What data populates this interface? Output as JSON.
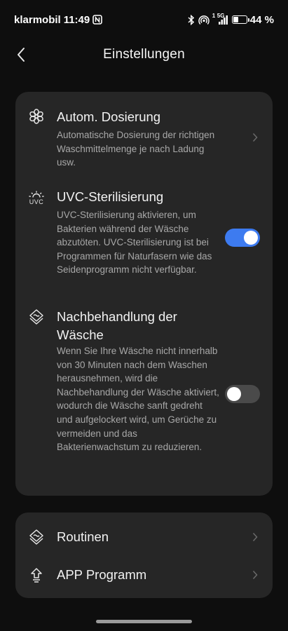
{
  "status_bar": {
    "carrier": "klarmobil",
    "time": "11:49",
    "network": "5G",
    "signal_sup": "1",
    "battery_percent_label": "44 %",
    "battery_level": 0.44
  },
  "header": {
    "title": "Einstellungen"
  },
  "settings": {
    "auto_dosing": {
      "title": "Autom. Dosierung",
      "description": "Automatische Dosierung der richtigen Waschmittelmenge je nach Ladung usw."
    },
    "uvc": {
      "title": "UVC-Sterilisierung",
      "icon_text": "UVC",
      "description": "UVC-Sterilisierung aktivieren, um Bakterien während der Wäsche abzutöten. UVC-Sterilisierung ist bei Programmen für Naturfasern wie das Seidenprogramm nicht verfügbar.",
      "enabled": true
    },
    "aftercare": {
      "title": "Nachbehandlung der Wäsche",
      "description": "Wenn Sie Ihre Wäsche nicht innerhalb von 30 Minuten nach dem Waschen herausnehmen, wird die Nachbehandlung der Wäsche aktiviert, wodurch die Wäsche sanft gedreht und aufgelockert wird, um Gerüche zu vermeiden und das Bakterienwachstum zu reduzieren.",
      "enabled": false
    }
  },
  "links": {
    "routines": {
      "title": "Routinen"
    },
    "app_program": {
      "title": "APP Programm"
    }
  },
  "colors": {
    "accent": "#3d7bf0",
    "card": "#262626",
    "background": "#0e0e0e"
  }
}
